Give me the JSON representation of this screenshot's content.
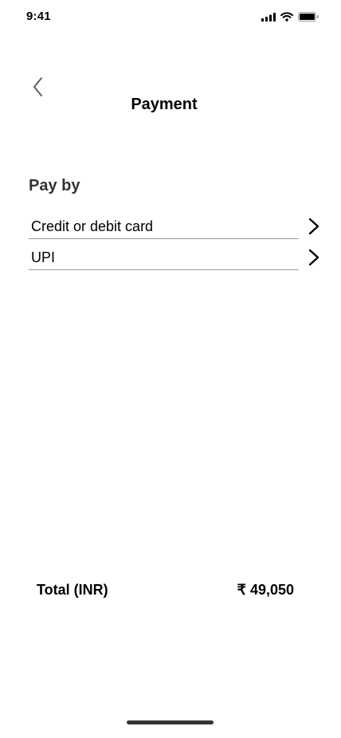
{
  "status": {
    "time": "9:41"
  },
  "header": {
    "title": "Payment"
  },
  "pay_by": {
    "label": "Pay by",
    "options": [
      {
        "label": "Credit or debit card"
      },
      {
        "label": "UPI"
      }
    ]
  },
  "total": {
    "label": "Total (INR)",
    "amount": "₹ 49,050"
  },
  "icons": {
    "signal": "cellular-signal-icon",
    "wifi": "wifi-icon",
    "battery": "battery-icon",
    "back": "chevron-left-icon",
    "forward": "chevron-right-icon"
  },
  "colors": {
    "back_icon": "#6b5a5a",
    "divider": "#9b9b9b"
  }
}
